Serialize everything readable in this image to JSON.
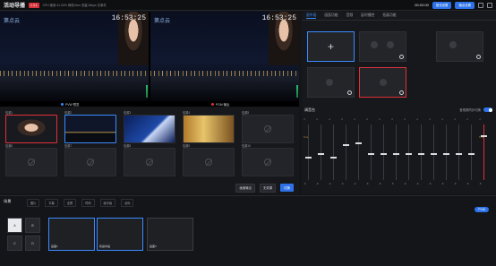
{
  "topbar": {
    "title": "活动导播",
    "version": "1.3.1",
    "stats": "CPU 使用:41.00%   网络:0ms   流量:0kbps   无事件",
    "rec_time": "00:02:00",
    "btn_primary": "推流设置",
    "btn_secondary": "输出设置"
  },
  "monitors": {
    "clock": "16:53:25",
    "logo": "第点云",
    "pvw_label": "PVW 预览",
    "pgm_label": "PGM 输出"
  },
  "sources": [
    {
      "name": "信源1",
      "state": "active"
    },
    {
      "name": "信源2",
      "state": "preview"
    },
    {
      "name": "信源3",
      "state": "normal"
    },
    {
      "name": "信源4",
      "state": "normal"
    },
    {
      "name": "信源5",
      "state": "empty"
    },
    {
      "name": "信源6",
      "state": "empty"
    },
    {
      "name": "信源7",
      "state": "empty"
    },
    {
      "name": "信源8",
      "state": "empty"
    },
    {
      "name": "信源9",
      "state": "empty"
    },
    {
      "name": "信源10",
      "state": "empty"
    }
  ],
  "controls": {
    "btn1": "画面输出",
    "btn2": "无效果",
    "btn3": "切换"
  },
  "right_tabs": [
    "画中画",
    "画面功能",
    "音频",
    "延时播控",
    "拓展功能"
  ],
  "mixer": {
    "title": "调音台",
    "toggle_label": "音视频同步切换",
    "channels": [
      {
        "val": "-9"
      },
      {
        "val": "-8"
      },
      {
        "val": "-9"
      },
      {
        "val": "-9"
      },
      {
        "val": "-9"
      },
      {
        "val": "-8"
      },
      {
        "val": "-8"
      },
      {
        "val": "-8"
      },
      {
        "val": "-8"
      },
      {
        "val": "-8"
      },
      {
        "val": "-8"
      },
      {
        "val": "-8"
      },
      {
        "val": "-8"
      },
      {
        "val": "-8"
      },
      {
        "val": "-8"
      }
    ],
    "mark_hi": "Tone"
  },
  "bottom": {
    "title": "场景",
    "tabs": [
      "图片",
      "字幕",
      "全屏",
      "时间",
      "画中画",
      "台标"
    ],
    "pvw_pill": "PVW",
    "letters": [
      "A",
      "B",
      "C",
      "D"
    ],
    "scenes": [
      "画面1",
      "新画中画",
      "画面3"
    ]
  },
  "colors": {
    "accent": "#2d72e8",
    "pgm": "#e0303a",
    "pvw": "#3a8bff"
  }
}
